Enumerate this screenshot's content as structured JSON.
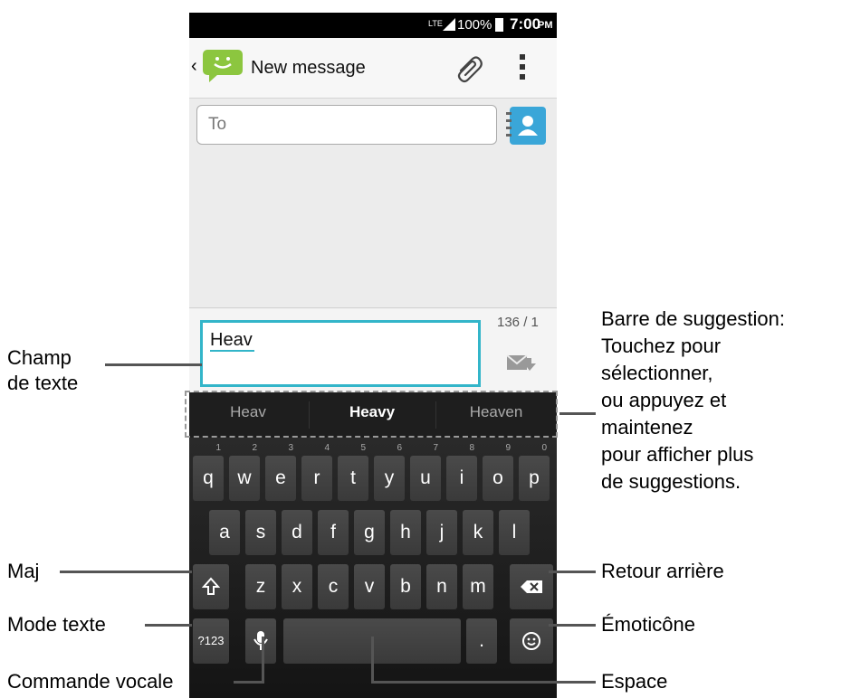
{
  "status_bar": {
    "signal": "LTE",
    "battery_pct": "100%",
    "time": "7:00",
    "ampm": "PM"
  },
  "action_bar": {
    "title": "New message"
  },
  "recipient": {
    "placeholder": "To"
  },
  "compose": {
    "text": "Heav",
    "counter": "136 / 1"
  },
  "suggestions": [
    "Heav",
    "Heavy",
    "Heaven"
  ],
  "keyboard": {
    "row1": [
      {
        "k": "q",
        "n": "1"
      },
      {
        "k": "w",
        "n": "2"
      },
      {
        "k": "e",
        "n": "3"
      },
      {
        "k": "r",
        "n": "4"
      },
      {
        "k": "t",
        "n": "5"
      },
      {
        "k": "y",
        "n": "6"
      },
      {
        "k": "u",
        "n": "7"
      },
      {
        "k": "i",
        "n": "8"
      },
      {
        "k": "o",
        "n": "9"
      },
      {
        "k": "p",
        "n": "0"
      }
    ],
    "row2": [
      "a",
      "s",
      "d",
      "f",
      "g",
      "h",
      "j",
      "k",
      "l"
    ],
    "row3": [
      "z",
      "x",
      "c",
      "v",
      "b",
      "n",
      "m"
    ],
    "mode_key": "?123",
    "period_key": "."
  },
  "callouts": {
    "text_field": "Champ\nde texte",
    "suggestion_bar": "Barre de suggestion:\nTouchez pour\nsélectionner,\nou appuyez et\nmaintenez\npour afficher plus\nde suggestions.",
    "shift": "Maj",
    "text_mode": "Mode texte",
    "voice": "Commande vocale",
    "backspace": "Retour arrière",
    "emoticon": "Émoticône",
    "space": "Espace"
  },
  "colors": {
    "accent": "#33b5c9",
    "message_icon_green": "#8cc63f",
    "contact_icon_blue": "#3aa6d8"
  }
}
